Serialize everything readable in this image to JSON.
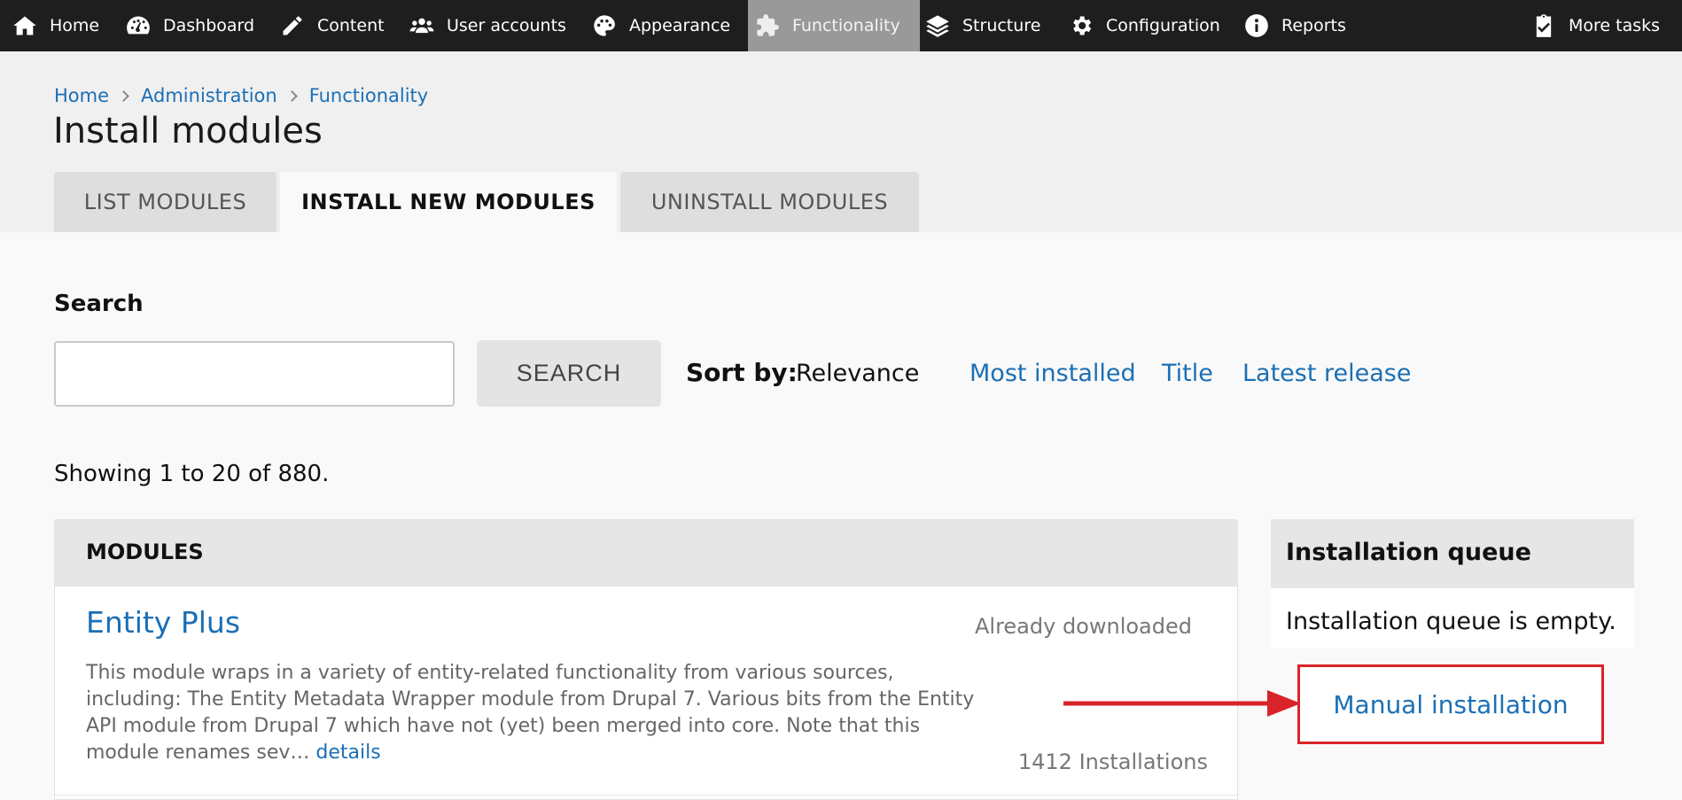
{
  "toolbar": {
    "items": [
      {
        "label": "Home",
        "icon": "home-icon"
      },
      {
        "label": "Dashboard",
        "icon": "dashboard-icon"
      },
      {
        "label": "Content",
        "icon": "pencil-icon"
      },
      {
        "label": "User accounts",
        "icon": "users-icon"
      },
      {
        "label": "Appearance",
        "icon": "palette-icon"
      },
      {
        "label": "Functionality",
        "icon": "puzzle-icon",
        "active": true
      },
      {
        "label": "Structure",
        "icon": "layers-icon"
      },
      {
        "label": "Configuration",
        "icon": "gear-icon"
      },
      {
        "label": "Reports",
        "icon": "info-icon"
      }
    ],
    "more_tasks": {
      "label": "More tasks",
      "icon": "clipboard-check-icon"
    }
  },
  "breadcrumb": [
    "Home",
    "Administration",
    "Functionality"
  ],
  "page_title": "Install modules",
  "tabs": [
    {
      "label": "LIST MODULES",
      "active": false
    },
    {
      "label": "INSTALL NEW MODULES",
      "active": true
    },
    {
      "label": "UNINSTALL MODULES",
      "active": false
    }
  ],
  "search": {
    "label": "Search",
    "value": "",
    "button_label": "SEARCH"
  },
  "sort": {
    "label": "Sort by:",
    "current": "Relevance",
    "options": [
      "Most installed",
      "Title",
      "Latest release"
    ]
  },
  "showing_text": "Showing 1 to 20 of 880.",
  "modules": {
    "header": "MODULES",
    "items": [
      {
        "name": "Entity Plus",
        "status": "Already downloaded",
        "description": "This module wraps in a variety of entity-related functionality from various sources, including: The Entity Metadata Wrapper module from Drupal 7. Various bits from the Entity API module from Drupal 7 which have not (yet) been merged into core. Note that this module renames sev…",
        "details_label": "details",
        "installations": "1412 Installations"
      }
    ]
  },
  "queue": {
    "title": "Installation queue",
    "empty_text": "Installation queue is empty."
  },
  "manual_installation_label": "Manual installation",
  "colors": {
    "toolbar_bg": "#1e1e1e",
    "toolbar_active": "#999999",
    "link": "#1b6fb5",
    "annotation_red": "#d9232a"
  }
}
